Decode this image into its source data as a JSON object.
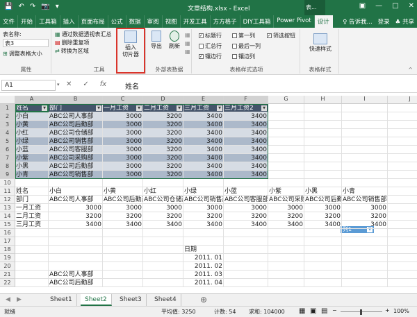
{
  "window": {
    "title": "文章结构.xlsx - Excel",
    "context_tab": "表...",
    "restore_icon": "restore-icon",
    "minimize": "—",
    "maximize": "□",
    "close": "✕"
  },
  "qat": {
    "save": "💾",
    "undo": "↶",
    "redo": "↷",
    "camera": "📷",
    "more": "▾"
  },
  "tabs": [
    "文件",
    "开始",
    "工具箱",
    "插入",
    "页面布局",
    "公式",
    "数据",
    "审阅",
    "视图",
    "开发工具",
    "方方格子",
    "DIY工具箱",
    "Power Pivot",
    "设计"
  ],
  "tabs_right": {
    "tell": "♀ 告诉我...",
    "login": "登录",
    "share": "♣ 共享"
  },
  "ribbon": {
    "props": {
      "table_name_label": "表名称:",
      "table_name": "表3",
      "resize": "调整表格大小",
      "group": "属性"
    },
    "tools": {
      "pivot": "通过数据透视表汇总",
      "remove_dup": "删除重复项",
      "convert": "转换为区域",
      "insert_slicer_line1": "插入",
      "insert_slicer_line2": "切片器",
      "group": "工具"
    },
    "external": {
      "export": "导出",
      "refresh": "刷新",
      "group": "外部表数据"
    },
    "style_opts": {
      "header_row": "标题行",
      "total_row": "汇总行",
      "banded_rows": "镶边行",
      "first_col": "第一列",
      "last_col": "最后一列",
      "banded_cols": "镶边列",
      "filter_btn": "筛选按钮",
      "group": "表格样式选项"
    },
    "styles": {
      "quick": "快速样式",
      "group": "表格样式"
    }
  },
  "formula": {
    "namebox": "A1",
    "cancel": "✕",
    "enter": "✓",
    "fx": "fx",
    "value": "姓名"
  },
  "columns": [
    "A",
    "B",
    "C",
    "D",
    "E",
    "F",
    "G",
    "H",
    "I",
    "J"
  ],
  "table": {
    "headers": [
      "姓名",
      "部门",
      "一月工资",
      "二月工资",
      "三月工资",
      "三月工资2"
    ],
    "rows": [
      [
        "小白",
        "ABC公司人事部",
        "3000",
        "3200",
        "3400",
        "3400"
      ],
      [
        "小黄",
        "ABC公司后勤部",
        "3000",
        "3200",
        "3400",
        "3400"
      ],
      [
        "小红",
        "ABC公司仓储部",
        "3000",
        "3200",
        "3400",
        "3400"
      ],
      [
        "小绿",
        "ABC公司销售部",
        "3000",
        "3200",
        "3400",
        "3400"
      ],
      [
        "小蓝",
        "ABC公司客服部",
        "3000",
        "3200",
        "3400",
        "3400"
      ],
      [
        "小紫",
        "ABC公司采购部",
        "3000",
        "3200",
        "3400",
        "3400"
      ],
      [
        "小黑",
        "ABC公司后勤部",
        "3000",
        "3200",
        "3400",
        "3400"
      ],
      [
        "小青",
        "ABC公司销售部",
        "3000",
        "3200",
        "3400",
        "3400"
      ]
    ]
  },
  "slicer": {
    "label": "列1"
  },
  "transposed": {
    "row11": [
      "姓名",
      "小白",
      "小黄",
      "小红",
      "小绿",
      "小蓝",
      "小紫",
      "小黑",
      "小青"
    ],
    "row12": [
      "部门",
      "ABC公司人事部",
      "ABC公司后勤部",
      "ABC公司仓储部",
      "ABC公司销售部",
      "ABC公司客服部",
      "ABC公司采购部",
      "ABC公司后勤部",
      "ABC公司销售部"
    ],
    "row13": [
      "一月工资",
      "3000",
      "3000",
      "3000",
      "3000",
      "3000",
      "3000",
      "3000",
      "3000"
    ],
    "row14": [
      "二月工资",
      "3200",
      "3200",
      "3200",
      "3200",
      "3200",
      "3200",
      "3200",
      "3200"
    ],
    "row15": [
      "三月工资",
      "3400",
      "3400",
      "3400",
      "3400",
      "3400",
      "3400",
      "3400",
      "3400"
    ]
  },
  "dates": {
    "header": "日期",
    "values": [
      "2011. 01",
      "2011. 02",
      "2011. 03",
      "2011. 04"
    ]
  },
  "col_b_lower": {
    "r21": "ABC公司人事部",
    "r22": "ABC公司后勤部"
  },
  "sheet_tabs": [
    "Sheet1",
    "Sheet2",
    "Sheet3",
    "Sheet4"
  ],
  "active_sheet": "Sheet2",
  "status": {
    "ready": "就绪",
    "avg": "平均值: 3250",
    "count": "计数: 54",
    "sum": "求和: 104000",
    "zoom": "100%"
  }
}
